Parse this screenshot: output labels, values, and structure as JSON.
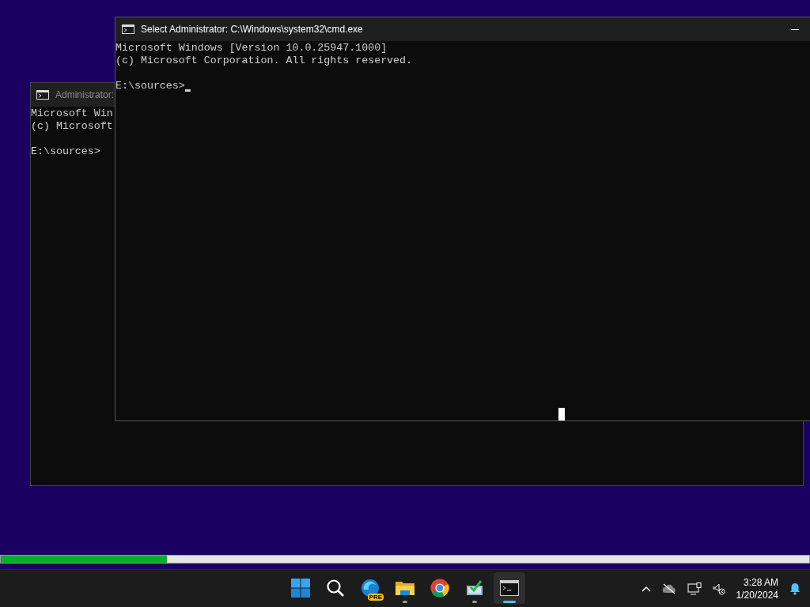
{
  "back_window": {
    "title": "Administrator:",
    "banner": [
      "Microsoft Win",
      "(c) Microsoft"
    ],
    "prompt": "E:\\sources>"
  },
  "front_window": {
    "title": "Select Administrator: C:\\Windows\\system32\\cmd.exe",
    "banner": [
      "Microsoft Windows [Version 10.0.25947.1000]",
      "(c) Microsoft Corporation. All rights reserved."
    ],
    "prompt": "E:\\sources>"
  },
  "progress": {
    "level": 0.205
  },
  "taskbar": {
    "apps": [
      {
        "kind": "start",
        "running": false,
        "selected": false
      },
      {
        "kind": "search",
        "running": false,
        "selected": false
      },
      {
        "kind": "edge",
        "badge": "PRE",
        "running": false,
        "selected": false
      },
      {
        "kind": "explorer",
        "running": true,
        "selected": false
      },
      {
        "kind": "chrome",
        "running": false,
        "selected": false
      },
      {
        "kind": "setup",
        "running": true,
        "selected": false
      },
      {
        "kind": "terminal",
        "running": true,
        "selected": true
      }
    ],
    "time": "3:28 AM",
    "date": "1/20/2024"
  }
}
